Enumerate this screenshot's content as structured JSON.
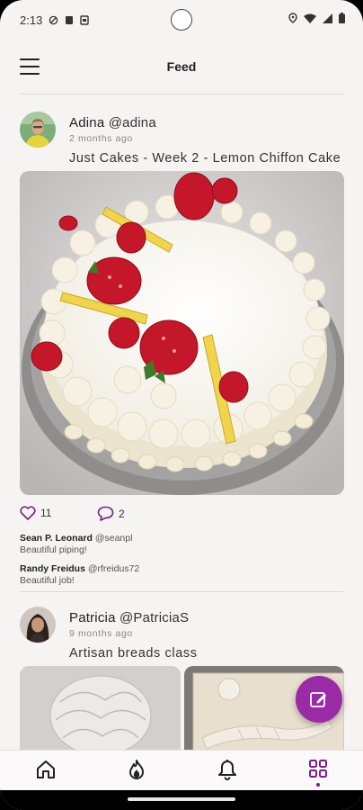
{
  "status_bar": {
    "time": "2:13",
    "left_icons": [
      "shield-icon",
      "card-icon",
      "image-icon"
    ],
    "right_icons": [
      "location-icon",
      "wifi-icon",
      "signal-icon",
      "battery-icon"
    ]
  },
  "app_bar": {
    "title": "Feed",
    "menu_icon": "hamburger-menu-icon"
  },
  "posts": [
    {
      "author_name": "Adina",
      "author_handle": "@adina",
      "time_ago": "2 months ago",
      "caption": "Just Cakes - Week 2 - Lemon Chiffon Cake",
      "image": "strawberry-lemon-cake-photo",
      "likes": "11",
      "comments_count": "2",
      "comments": [
        {
          "author_name": "Sean P. Leonard",
          "author_handle": "@seanpl",
          "text": "Beautiful piping!"
        },
        {
          "author_name": "Randy Freidus",
          "author_handle": "@rfreidus72",
          "text": "Beautiful job!"
        }
      ]
    },
    {
      "author_name": "Patricia",
      "author_handle": "@PatriciaS",
      "time_ago": "9 months ago",
      "caption": "Artisan breads class",
      "images": [
        "braided-bread-photo",
        "bread-dough-tray-photo"
      ]
    }
  ],
  "fab": {
    "icon": "edit-icon",
    "color": "#9b2aa6"
  },
  "bottom_nav": {
    "items": [
      {
        "name": "home",
        "icon": "home-icon"
      },
      {
        "name": "trending",
        "icon": "fire-icon"
      },
      {
        "name": "notifications",
        "icon": "bell-icon"
      },
      {
        "name": "more",
        "icon": "grid-icon",
        "active": true
      }
    ],
    "active_color": "#7a1e86"
  }
}
